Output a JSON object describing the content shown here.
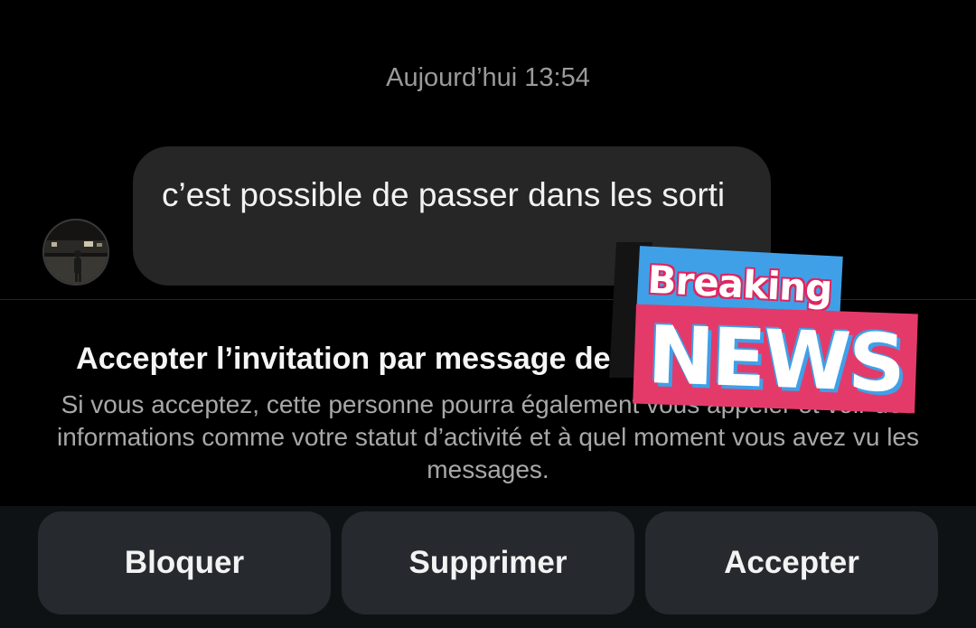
{
  "conversation": {
    "timestamp": "Aujourd’hui 13:54",
    "message": {
      "text": "c’est possible de passer dans les sorti"
    },
    "sender_avatar_icon": "avatar-photo"
  },
  "invite": {
    "title": "Accepter l’invitation par message de ",
    "title_end": "?",
    "description": "Si vous acceptez, cette personne pourra également vous appeler et voir des informations comme votre statut d’activité et à quel moment vous avez vu les messages."
  },
  "actions": {
    "block_label": "Bloquer",
    "delete_label": "Supprimer",
    "accept_label": "Accepter"
  },
  "sticker": {
    "line1": "Breaking",
    "line2": "NEWS"
  },
  "colors": {
    "background": "#000000",
    "bubble": "#262626",
    "button": "#262a2f",
    "sticker_blue": "#3fa0e8",
    "sticker_pink": "#e43a6a"
  }
}
